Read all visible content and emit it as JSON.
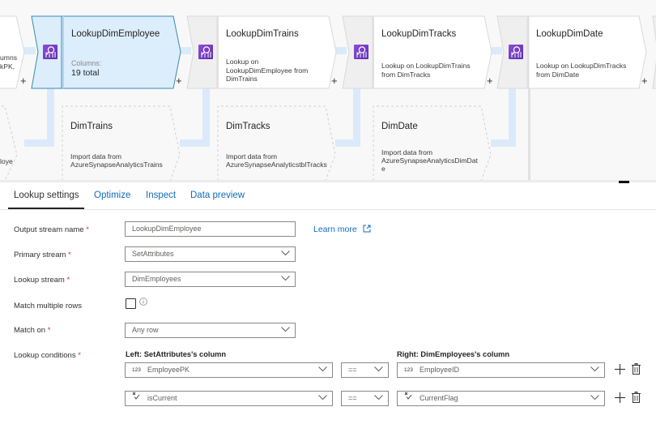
{
  "canvas": {
    "lookup_nodes": [
      {
        "title": "",
        "desc": "umns\nkPK,",
        "partial": true
      },
      {
        "title": "LookupDimEmployee",
        "columns_label": "Columns:",
        "columns_value": "19 total",
        "selected": true
      },
      {
        "title": "LookupDimTrains",
        "desc": "Lookup on\nLookupDimEmployee from\nDimTrains"
      },
      {
        "title": "LookupDimTracks",
        "desc": "Lookup on LookupDimTrains\nfrom DimTracks"
      },
      {
        "title": "LookupDimDate",
        "desc": "Lookup on LookupDimTracks\nfrom DimDate"
      }
    ],
    "add_label": "+",
    "source_nodes": [
      {
        "title": "",
        "desc": "loye",
        "partial": true
      },
      {
        "title": "DimTrains",
        "desc": "Import data from\nAzureSynapseAnalyticsTrains"
      },
      {
        "title": "DimTracks",
        "desc": "Import data from\nAzureSynapseAnalyticstblTracks"
      },
      {
        "title": "DimDate",
        "desc": "Import data from\nAzureSynapseAnalyticsDimDat\ne"
      }
    ],
    "colors": {
      "selected_fill": "#dcedfc",
      "selected_border": "#3a8bb0",
      "connector": "#dbeafb",
      "icon_purple": "#7a3fc8"
    }
  },
  "tabs": [
    {
      "label": "Lookup settings",
      "active": true
    },
    {
      "label": "Optimize",
      "active": false
    },
    {
      "label": "Inspect",
      "active": false
    },
    {
      "label": "Data preview",
      "active": false
    }
  ],
  "form": {
    "output_stream": {
      "label": "Output stream name",
      "required": "*",
      "value": "LookupDimEmployee"
    },
    "learn_more": "Learn more",
    "primary_stream": {
      "label": "Primary stream",
      "required": "*",
      "value": "SetAttributes"
    },
    "lookup_stream": {
      "label": "Lookup stream",
      "required": "*",
      "value": "DimEmployees"
    },
    "match_multiple": {
      "label": "Match multiple rows",
      "checked": false
    },
    "match_on": {
      "label": "Match on",
      "required": "*",
      "value": "Any row"
    },
    "lookup_conditions": {
      "label": "Lookup conditions",
      "required": "*",
      "left_header": "Left: SetAttributes's column",
      "right_header": "Right: DimEmployees's column",
      "rows": [
        {
          "left_type": "123",
          "left": "EmployeePK",
          "op": "==",
          "right_type": "123",
          "right": "EmployeeID"
        },
        {
          "left_type": "bool",
          "left": "isCurrent",
          "op": "==",
          "right_type": "bool",
          "right": "CurrentFlag"
        }
      ]
    }
  }
}
